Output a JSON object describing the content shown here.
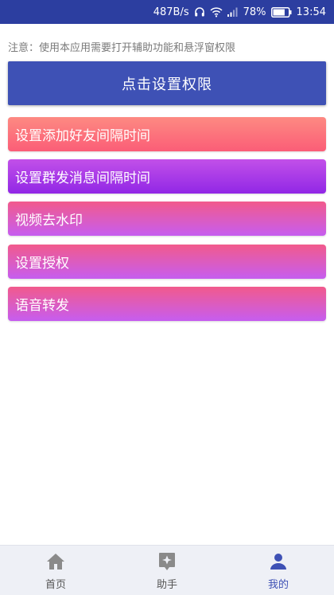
{
  "status_bar": {
    "net_speed": "487B/s",
    "battery_percent": "78%",
    "time": "13:54",
    "battery_level": 0.78,
    "icons": [
      "headphone-icon",
      "wifi-icon",
      "signal-icon",
      "battery-icon"
    ]
  },
  "notice": "注意：使用本应用需要打开辅助功能和悬浮窗权限",
  "primary_button": {
    "label": "点击设置权限",
    "color": "#3e51b5"
  },
  "features": [
    {
      "label": "设置添加好友间隔时间",
      "gradient": [
        "#fd8a82",
        "#fb5d77"
      ]
    },
    {
      "label": "设置群发消息间隔时间",
      "gradient": [
        "#c250e8",
        "#9127e6"
      ]
    },
    {
      "label": "视频去水印",
      "gradient": [
        "#f25a8c",
        "#c65df0"
      ]
    },
    {
      "label": "设置授权",
      "gradient": [
        "#f25a8c",
        "#c65df0"
      ]
    },
    {
      "label": "语音转发",
      "gradient": [
        "#f25a8c",
        "#c65df0"
      ]
    }
  ],
  "bottom_nav": {
    "items": [
      {
        "label": "首页",
        "icon": "home-icon",
        "active": false
      },
      {
        "label": "助手",
        "icon": "assistant-icon",
        "active": false
      },
      {
        "label": "我的",
        "icon": "person-icon",
        "active": true
      }
    ],
    "active_color": "#3e51b5",
    "inactive_color": "#8a8a8a"
  }
}
